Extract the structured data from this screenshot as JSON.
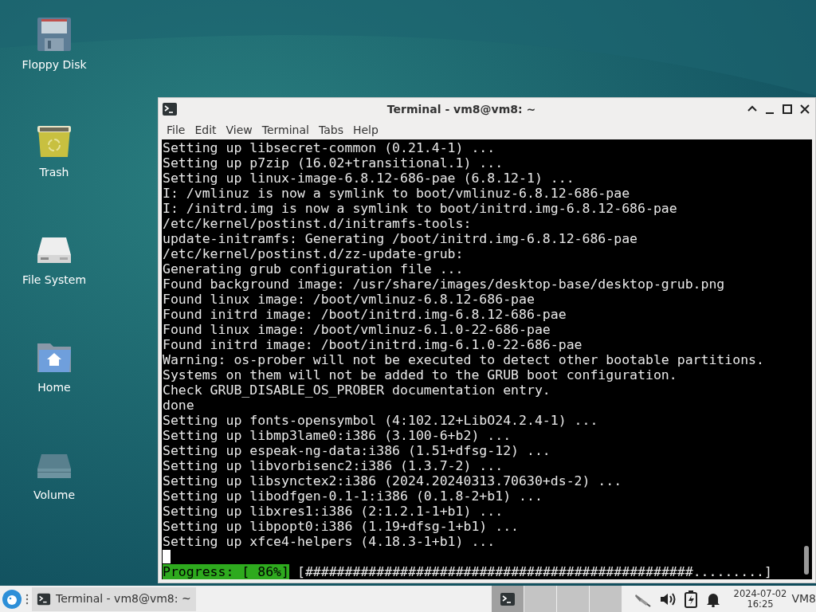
{
  "desktop_icons": [
    {
      "kind": "floppy",
      "label": "Floppy Disk"
    },
    {
      "kind": "trash",
      "label": "Trash"
    },
    {
      "kind": "drive",
      "label": "File System"
    },
    {
      "kind": "home",
      "label": "Home"
    },
    {
      "kind": "volume",
      "label": "Volume"
    }
  ],
  "window": {
    "title": "Terminal - vm8@vm8: ~",
    "menu": [
      "File",
      "Edit",
      "View",
      "Terminal",
      "Tabs",
      "Help"
    ],
    "lines": [
      "Setting up libsecret-common (0.21.4-1) ...",
      "Setting up p7zip (16.02+transitional.1) ...",
      "Setting up linux-image-6.8.12-686-pae (6.8.12-1) ...",
      "I: /vmlinuz is now a symlink to boot/vmlinuz-6.8.12-686-pae",
      "I: /initrd.img is now a symlink to boot/initrd.img-6.8.12-686-pae",
      "/etc/kernel/postinst.d/initramfs-tools:",
      "update-initramfs: Generating /boot/initrd.img-6.8.12-686-pae",
      "/etc/kernel/postinst.d/zz-update-grub:",
      "Generating grub configuration file ...",
      "Found background image: /usr/share/images/desktop-base/desktop-grub.png",
      "Found linux image: /boot/vmlinuz-6.8.12-686-pae",
      "Found initrd image: /boot/initrd.img-6.8.12-686-pae",
      "Found linux image: /boot/vmlinuz-6.1.0-22-686-pae",
      "Found initrd image: /boot/initrd.img-6.1.0-22-686-pae",
      "Warning: os-prober will not be executed to detect other bootable partitions.",
      "Systems on them will not be added to the GRUB boot configuration.",
      "Check GRUB_DISABLE_OS_PROBER documentation entry.",
      "done",
      "Setting up fonts-opensymbol (4:102.12+LibO24.2.4-1) ...",
      "Setting up libmp3lame0:i386 (3.100-6+b2) ...",
      "Setting up espeak-ng-data:i386 (1.51+dfsg-12) ...",
      "Setting up libvorbisenc2:i386 (1.3.7-2) ...",
      "Setting up libsynctex2:i386 (2024.20240313.70630+ds-2) ...",
      "Setting up libodfgen-0.1-1:i386 (0.1.8-2+b1) ...",
      "Setting up libxres1:i386 (2:1.2.1-1+b1) ...",
      "Setting up libpopt0:i386 (1.19+dfsg-1+b1) ...",
      "Setting up xfce4-helpers (4.18.3-1+b1) ..."
    ],
    "progress": {
      "label": "Progress: [ 86%]",
      "bar": "[#################################################.........]"
    }
  },
  "taskbar": {
    "tasks": [
      {
        "title": "Terminal - vm8@vm8: ~",
        "selected": true
      }
    ],
    "workspaces": [
      {
        "selected": true
      },
      {
        "selected": false
      },
      {
        "selected": false
      },
      {
        "selected": false
      }
    ],
    "date": "2024-07-02",
    "time": "16:25",
    "user": "VM8"
  }
}
